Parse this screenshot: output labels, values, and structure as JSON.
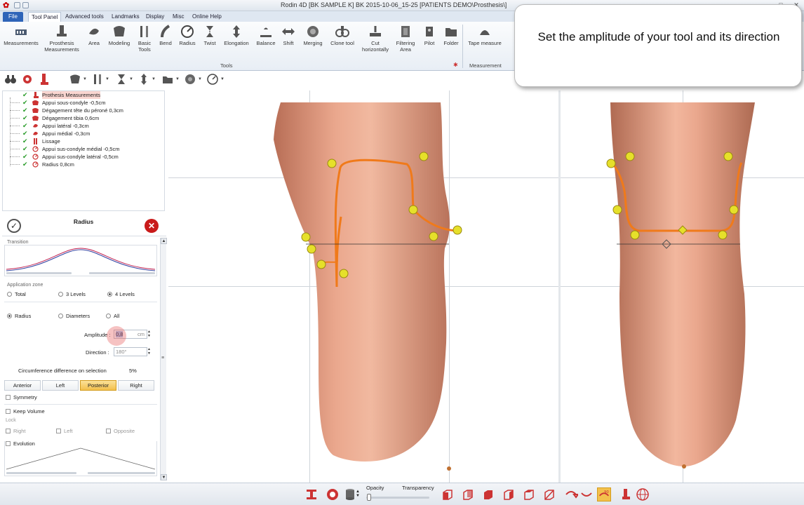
{
  "window": {
    "title": "Rodin 4D [BK SAMPLE K] BK 2015-10-06_15-25 [PATIENTS DEMO\\Prosthesis\\]"
  },
  "ribbon_tabs": [
    {
      "label": "File"
    },
    {
      "label": "Tool Panel"
    },
    {
      "label": "Advanced tools"
    },
    {
      "label": "Landmarks"
    },
    {
      "label": "Display"
    },
    {
      "label": "Misc"
    },
    {
      "label": "Online Help"
    }
  ],
  "ribbon_buttons": [
    {
      "label": "Measurements",
      "icon": "measurements-icon"
    },
    {
      "label": "Prosthesis\nMeasurements",
      "icon": "prosthesis-measurements-icon"
    },
    {
      "label": "Area",
      "icon": "area-icon"
    },
    {
      "label": "Modeling",
      "icon": "modeling-icon"
    },
    {
      "label": "Basic\nTools",
      "icon": "basic-tools-icon"
    },
    {
      "label": "Bend",
      "icon": "bend-icon"
    },
    {
      "label": "Radius",
      "icon": "radius-icon"
    },
    {
      "label": "Twist",
      "icon": "twist-icon"
    },
    {
      "label": "Elongation",
      "icon": "elongation-icon"
    },
    {
      "label": "Balance",
      "icon": "balance-icon"
    },
    {
      "label": "Shift",
      "icon": "shift-icon"
    },
    {
      "label": "Merging",
      "icon": "merging-icon"
    },
    {
      "label": "Clone tool",
      "icon": "clone-tool-icon"
    },
    {
      "label": "Cut\nhorizontally",
      "icon": "cut-horizontally-icon"
    },
    {
      "label": "Filtering\nArea",
      "icon": "filtering-area-icon"
    },
    {
      "label": "Pilot",
      "icon": "pilot-icon"
    },
    {
      "label": "Folder",
      "icon": "folder-icon"
    },
    {
      "label": "Tape measure",
      "icon": "tape-measure-icon"
    }
  ],
  "ribbon_groups": {
    "tools": "Tools",
    "measurement": "Measurement"
  },
  "tree": {
    "items": [
      {
        "label": "Prothesis Measurements",
        "selected": true
      },
      {
        "label": "Appui sous-condyle  -0,5cm"
      },
      {
        "label": "Dégagement tête du péroné  0,3cm"
      },
      {
        "label": "Dégagement tibia  0,6cm"
      },
      {
        "label": "Appui latéral  -0,3cm"
      },
      {
        "label": "Appui médial  -0,3cm"
      },
      {
        "label": "Lissage"
      },
      {
        "label": "Appui sus-condyle médial  -0,5cm"
      },
      {
        "label": "Appui sus-condyle latéral  -0,5cm"
      },
      {
        "label": "Radius  0,8cm"
      }
    ]
  },
  "radius_panel": {
    "title": "Radius",
    "transition_label": "Transition",
    "application_zone_label": "Application zone",
    "zone_options": [
      {
        "label": "Total",
        "selected": false
      },
      {
        "label": "3 Levels",
        "selected": false
      },
      {
        "label": "4 Levels",
        "selected": true
      }
    ],
    "measure_options": [
      {
        "label": "Radius",
        "selected": true
      },
      {
        "label": "Diameters",
        "selected": false
      },
      {
        "label": "All",
        "selected": false
      }
    ],
    "amplitude_label": "Amplitude :",
    "amplitude_value": "0,8",
    "amplitude_unit": "cm",
    "direction_label": "Direction :",
    "direction_value": "180°",
    "circumference_label": "Circumference difference on selection",
    "circumference_value": "5%",
    "side_buttons": [
      {
        "label": "Anterior",
        "active": false
      },
      {
        "label": "Left",
        "active": false
      },
      {
        "label": "Posterior",
        "active": true
      },
      {
        "label": "Right",
        "active": false
      }
    ],
    "symmetry_label": "Symmetry",
    "keep_volume_label": "Keep Volume",
    "lock_label": "Lock",
    "lock_options": [
      "Right",
      "Left",
      "Opposite"
    ],
    "evolution_label": "Evolution"
  },
  "callout": {
    "text": "Set the amplitude of your tool and its direction"
  },
  "bottom_bar": {
    "opacity_label": "Opacity",
    "transparency_label": "Transparency",
    "opacity_level": 0.0
  },
  "colors": {
    "accent": "#2e64b8",
    "active_button": "#f3c04c",
    "curve": "#f07a1a",
    "control_point": "#e6e02a",
    "skin": "#e8a58a",
    "cancel": "#c91a1a",
    "check": "#2a9c2a"
  }
}
